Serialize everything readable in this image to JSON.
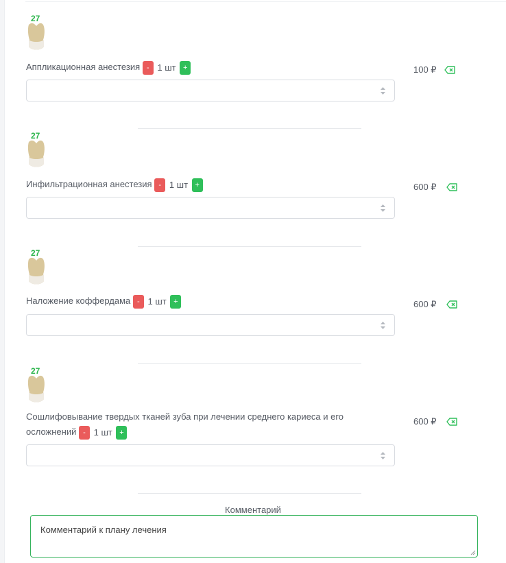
{
  "items": [
    {
      "tooth": "27",
      "name": "Аппликационная анестезия",
      "minus": "-",
      "qty": "1 шт",
      "plus": "+",
      "price": "100 ₽",
      "delete_icon": "backspace-icon"
    },
    {
      "tooth": "27",
      "name": "Инфильтрационная анестезия",
      "minus": "-",
      "qty": "1 шт",
      "plus": "+",
      "price": "600 ₽",
      "delete_icon": "backspace-icon"
    },
    {
      "tooth": "27",
      "name": "Наложение коффердама",
      "minus": "-",
      "qty": "1 шт",
      "plus": "+",
      "price": "600 ₽",
      "delete_icon": "backspace-icon"
    },
    {
      "tooth": "27",
      "name": "Сошлифовывание твердых тканей зуба при лечении среднего кариеса и его осложнений",
      "minus": "-",
      "qty": "1 шт",
      "plus": "+",
      "price": "600 ₽",
      "delete_icon": "backspace-icon"
    }
  ],
  "comment": {
    "label": "Комментарий",
    "value": "Комментарий к плану лечения"
  },
  "colors": {
    "accent": "#2fbf5a",
    "minus": "#ea5b5b",
    "tooth_number": "#2bb54b"
  }
}
